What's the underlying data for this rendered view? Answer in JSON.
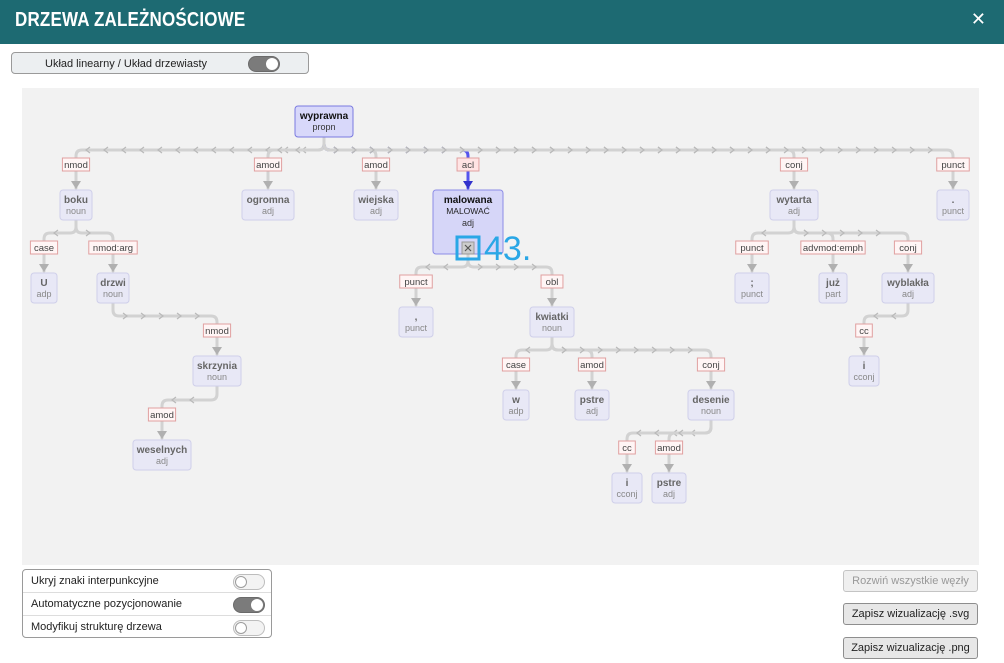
{
  "header": {
    "title": "DRZEWA ZALEŻNOŚCIOWE",
    "close": "✕"
  },
  "layout_toggle": {
    "label": "Układ linearny / Układ drzewiasty",
    "on": true
  },
  "tree": {
    "nodes": [
      {
        "id": "wyprawna",
        "word": "wyprawna",
        "pos": "propn",
        "state": "root"
      },
      {
        "id": "boku",
        "word": "boku",
        "pos": "noun"
      },
      {
        "id": "ogromna",
        "word": "ogromna",
        "pos": "adj"
      },
      {
        "id": "wiejska",
        "word": "wiejska",
        "pos": "adj"
      },
      {
        "id": "malowana",
        "word": "malowana",
        "lemma": "MALOWAĆ",
        "pos": "adj",
        "state": "selected"
      },
      {
        "id": "wytarta",
        "word": "wytarta",
        "pos": "adj"
      },
      {
        "id": "dot",
        "word": ".",
        "pos": "punct"
      },
      {
        "id": "U",
        "word": "U",
        "pos": "adp"
      },
      {
        "id": "drzwi",
        "word": "drzwi",
        "pos": "noun"
      },
      {
        "id": "skrzynia",
        "word": "skrzynia",
        "pos": "noun"
      },
      {
        "id": "weselnych",
        "word": "weselnych",
        "pos": "adj"
      },
      {
        "id": "comma",
        "word": ",",
        "pos": "punct"
      },
      {
        "id": "kwiatki",
        "word": "kwiatki",
        "pos": "noun"
      },
      {
        "id": "w",
        "word": "w",
        "pos": "adp"
      },
      {
        "id": "pstre1",
        "word": "pstre",
        "pos": "adj"
      },
      {
        "id": "desenie",
        "word": "desenie",
        "pos": "noun"
      },
      {
        "id": "i1",
        "word": "i",
        "pos": "cconj"
      },
      {
        "id": "pstre2",
        "word": "pstre",
        "pos": "adj"
      },
      {
        "id": "semicolon",
        "word": ";",
        "pos": "punct"
      },
      {
        "id": "juz",
        "word": "już",
        "pos": "part"
      },
      {
        "id": "wyblakla",
        "word": "wyblakła",
        "pos": "adj"
      },
      {
        "id": "i2",
        "word": "i",
        "pos": "cconj"
      }
    ],
    "edges": [
      {
        "from": "wyprawna",
        "to": "boku",
        "rel": "nmod"
      },
      {
        "from": "wyprawna",
        "to": "ogromna",
        "rel": "amod"
      },
      {
        "from": "wyprawna",
        "to": "wiejska",
        "rel": "amod"
      },
      {
        "from": "wyprawna",
        "to": "malowana",
        "rel": "acl",
        "highlight": true
      },
      {
        "from": "wyprawna",
        "to": "wytarta",
        "rel": "conj"
      },
      {
        "from": "wyprawna",
        "to": "dot",
        "rel": "punct"
      },
      {
        "from": "boku",
        "to": "U",
        "rel": "case"
      },
      {
        "from": "boku",
        "to": "drzwi",
        "rel": "nmod:arg"
      },
      {
        "from": "drzwi",
        "to": "skrzynia",
        "rel": "nmod"
      },
      {
        "from": "skrzynia",
        "to": "weselnych",
        "rel": "amod"
      },
      {
        "from": "malowana",
        "to": "comma",
        "rel": "punct"
      },
      {
        "from": "malowana",
        "to": "kwiatki",
        "rel": "obl"
      },
      {
        "from": "kwiatki",
        "to": "w",
        "rel": "case"
      },
      {
        "from": "kwiatki",
        "to": "pstre1",
        "rel": "amod"
      },
      {
        "from": "kwiatki",
        "to": "desenie",
        "rel": "conj"
      },
      {
        "from": "desenie",
        "to": "i1",
        "rel": "cc"
      },
      {
        "from": "desenie",
        "to": "pstre2",
        "rel": "amod"
      },
      {
        "from": "wytarta",
        "to": "semicolon",
        "rel": "punct"
      },
      {
        "from": "wytarta",
        "to": "juz",
        "rel": "advmod:emph"
      },
      {
        "from": "wytarta",
        "to": "wyblakla",
        "rel": "conj"
      },
      {
        "from": "wyblakla",
        "to": "i2",
        "rel": "cc"
      }
    ],
    "collapse_icon": "collapse-icon",
    "node_index": "43."
  },
  "options": [
    {
      "label": "Ukryj znaki interpunkcyjne",
      "on": false
    },
    {
      "label": "Automatyczne pozycjonowanie",
      "on": true
    },
    {
      "label": "Modyfikuj strukturę drzewa",
      "on": false
    }
  ],
  "buttons": {
    "expand_all": "Rozwiń wszystkie węzły",
    "save_svg": "Zapisz wizualizację .svg",
    "save_png": "Zapisz wizualizację .png"
  },
  "colors": {
    "header": "#1d6a72",
    "accent": "#4444dd",
    "selection": "#2aa7e6",
    "label_border": "#e0a0a0"
  }
}
